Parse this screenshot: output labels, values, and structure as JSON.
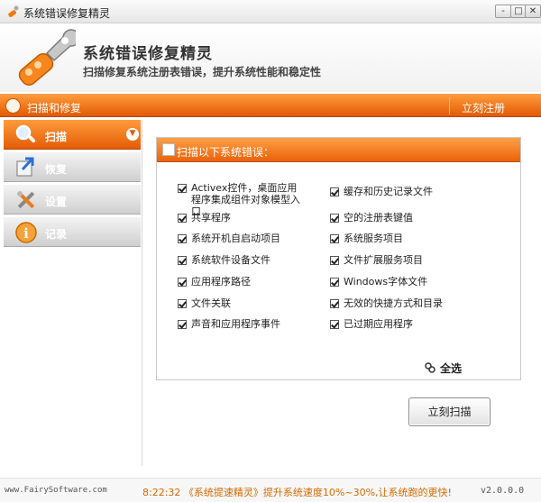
{
  "window": {
    "title": "系统错误修复精灵",
    "min_symbol": "-",
    "max_symbol": "□",
    "close_symbol": "✕"
  },
  "header": {
    "app_name": "系统错误修复精灵",
    "tagline": "扫描修复系统注册表错误，提升系统性能和稳定性"
  },
  "top_bar": {
    "title": "扫描和修复",
    "repair_link": "立刻注册"
  },
  "sidebar": {
    "items": [
      {
        "label": "扫描",
        "icon": "magnifier-icon",
        "active": true
      },
      {
        "label": "恢复",
        "icon": "restore-icon",
        "active": false
      },
      {
        "label": "设置",
        "icon": "tools-icon",
        "active": false
      },
      {
        "label": "记录",
        "icon": "info-icon",
        "active": false
      }
    ]
  },
  "panel": {
    "title": "扫描以下系统错误：",
    "left_options": [
      {
        "label": "Activex控件，桌面应用程序集成组件对象模型入口",
        "checked": true
      },
      {
        "label": "共享程序",
        "checked": true
      },
      {
        "label": "系统开机自启动项目",
        "checked": true
      },
      {
        "label": "系统软件设备文件",
        "checked": true
      },
      {
        "label": "应用程序路径",
        "checked": true
      },
      {
        "label": "文件关联",
        "checked": true
      },
      {
        "label": "声音和应用程序事件",
        "checked": true
      }
    ],
    "right_options": [
      {
        "label": "缓存和历史记录文件",
        "checked": true
      },
      {
        "label": "空的注册表键值",
        "checked": true
      },
      {
        "label": "系统服务项目",
        "checked": true
      },
      {
        "label": "文件扩展服务项目",
        "checked": true
      },
      {
        "label": "Windows字体文件",
        "checked": true
      },
      {
        "label": "无效的快捷方式和目录",
        "checked": true
      },
      {
        "label": "已过期应用程序",
        "checked": true
      }
    ],
    "select_all": "全选"
  },
  "actions": {
    "scan_now": "立刻扫描"
  },
  "footer": {
    "site": "www.FairySoftware.com",
    "message": "8:22:32 《系统提速精灵》提升系统速度10%~30%,让系统跑的更快!",
    "version": "v2.0.0.0"
  },
  "colors": {
    "accent": "#ee6a10",
    "footer_message": "#d56a00"
  }
}
